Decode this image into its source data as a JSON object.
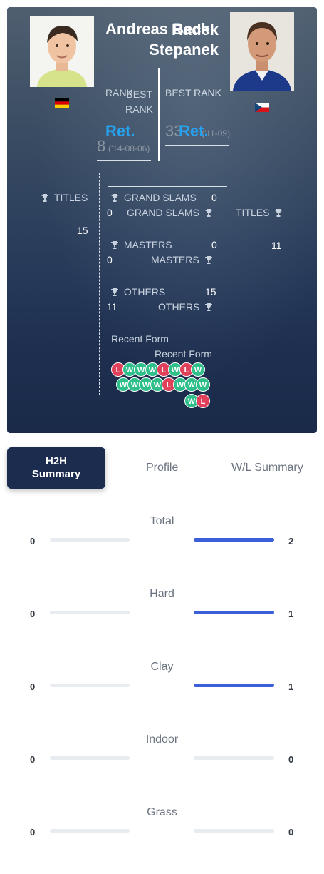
{
  "player1": {
    "name": "Andreas Beck",
    "country": "Germany",
    "rank_label": "RANK",
    "rank_value": "Ret.",
    "best_rank_label": "BEST RANK",
    "best_rank_value": "8",
    "best_rank_date": "('14-08-06)",
    "titles_label": "TITLES",
    "titles_value": "15",
    "grand_slams_value": "0",
    "masters_value": "0",
    "others_value": "11"
  },
  "player2": {
    "name": "Radek Stepanek",
    "country": "Czech Republic",
    "rank_label": "RANK",
    "rank_value": "Ret.",
    "best_rank_label": "BEST RANK",
    "best_rank_value": "33",
    "best_rank_date": "('11-09)",
    "titles_label": "TITLES",
    "titles_value": "11",
    "grand_slams_value": "0",
    "masters_value": "0",
    "others_value": "15"
  },
  "stats": {
    "grand_slams_label": "GRAND SLAMS",
    "masters_label": "MASTERS",
    "others_label": "OTHERS",
    "recent_form_label": "Recent Form"
  },
  "recent_form": {
    "row1": [
      "L",
      "W",
      "W",
      "W",
      "L",
      "W",
      "L",
      "W"
    ],
    "row2": [
      "W",
      "W",
      "W",
      "W",
      "L",
      "W",
      "W",
      "W"
    ],
    "row3": [
      "W",
      "L"
    ]
  },
  "tabs": {
    "h2h": "H2H Summary",
    "h2h_line1": "H2H",
    "h2h_line2": "Summary",
    "profile": "Profile",
    "wl": "W/L Summary"
  },
  "summary": [
    {
      "label": "Total",
      "left": "0",
      "right": "2",
      "left_frac": 0,
      "right_frac": 1
    },
    {
      "label": "Hard",
      "left": "0",
      "right": "1",
      "left_frac": 0,
      "right_frac": 1
    },
    {
      "label": "Clay",
      "left": "0",
      "right": "1",
      "left_frac": 0,
      "right_frac": 1
    },
    {
      "label": "Indoor",
      "left": "0",
      "right": "0",
      "left_frac": 0,
      "right_frac": 0
    },
    {
      "label": "Grass",
      "left": "0",
      "right": "0",
      "left_frac": 0,
      "right_frac": 0
    }
  ],
  "colors": {
    "win": "#2fbf8a",
    "loss": "#e0405a",
    "accent": "#27a0ee",
    "bar": "#3a5fd8"
  }
}
